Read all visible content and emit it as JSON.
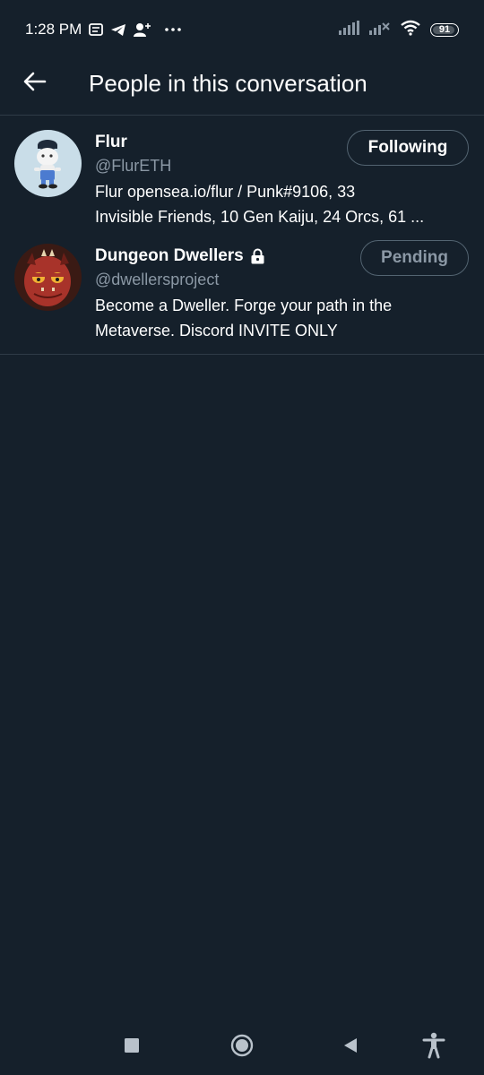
{
  "status_bar": {
    "time": "1:28 PM",
    "icons": [
      "message-icon",
      "telegram-icon",
      "person-add-icon",
      "more-dots-icon",
      "signal-icon",
      "signal-off-icon",
      "wifi-icon"
    ],
    "battery_level": "91"
  },
  "header": {
    "back_icon": "arrow-left-icon",
    "title": "People in this conversation"
  },
  "people": [
    {
      "name": "Flur",
      "handle": "@FlurETH",
      "bio_line1": "Flur opensea.io/flur / Punk#9106, 33",
      "bio_line2": "Invisible Friends, 10 Gen Kaiju, 24 Orcs, 61 ...",
      "button_label": "Following",
      "locked": false
    },
    {
      "name": "Dungeon Dwellers",
      "handle": "@dwellersproject",
      "bio_line1": "Become a Dweller. Forge your path in the",
      "bio_line2": "Metaverse. Discord INVITE ONLY",
      "button_label": "Pending",
      "locked": true
    }
  ],
  "nav_bar": {
    "icons": [
      "recents-square-icon",
      "home-circle-icon",
      "back-triangle-icon",
      "accessibility-icon"
    ]
  },
  "colors": {
    "background": "#15202b",
    "divider": "#2f3b47",
    "secondary_text": "#8b98a5",
    "button_border": "#536471"
  }
}
